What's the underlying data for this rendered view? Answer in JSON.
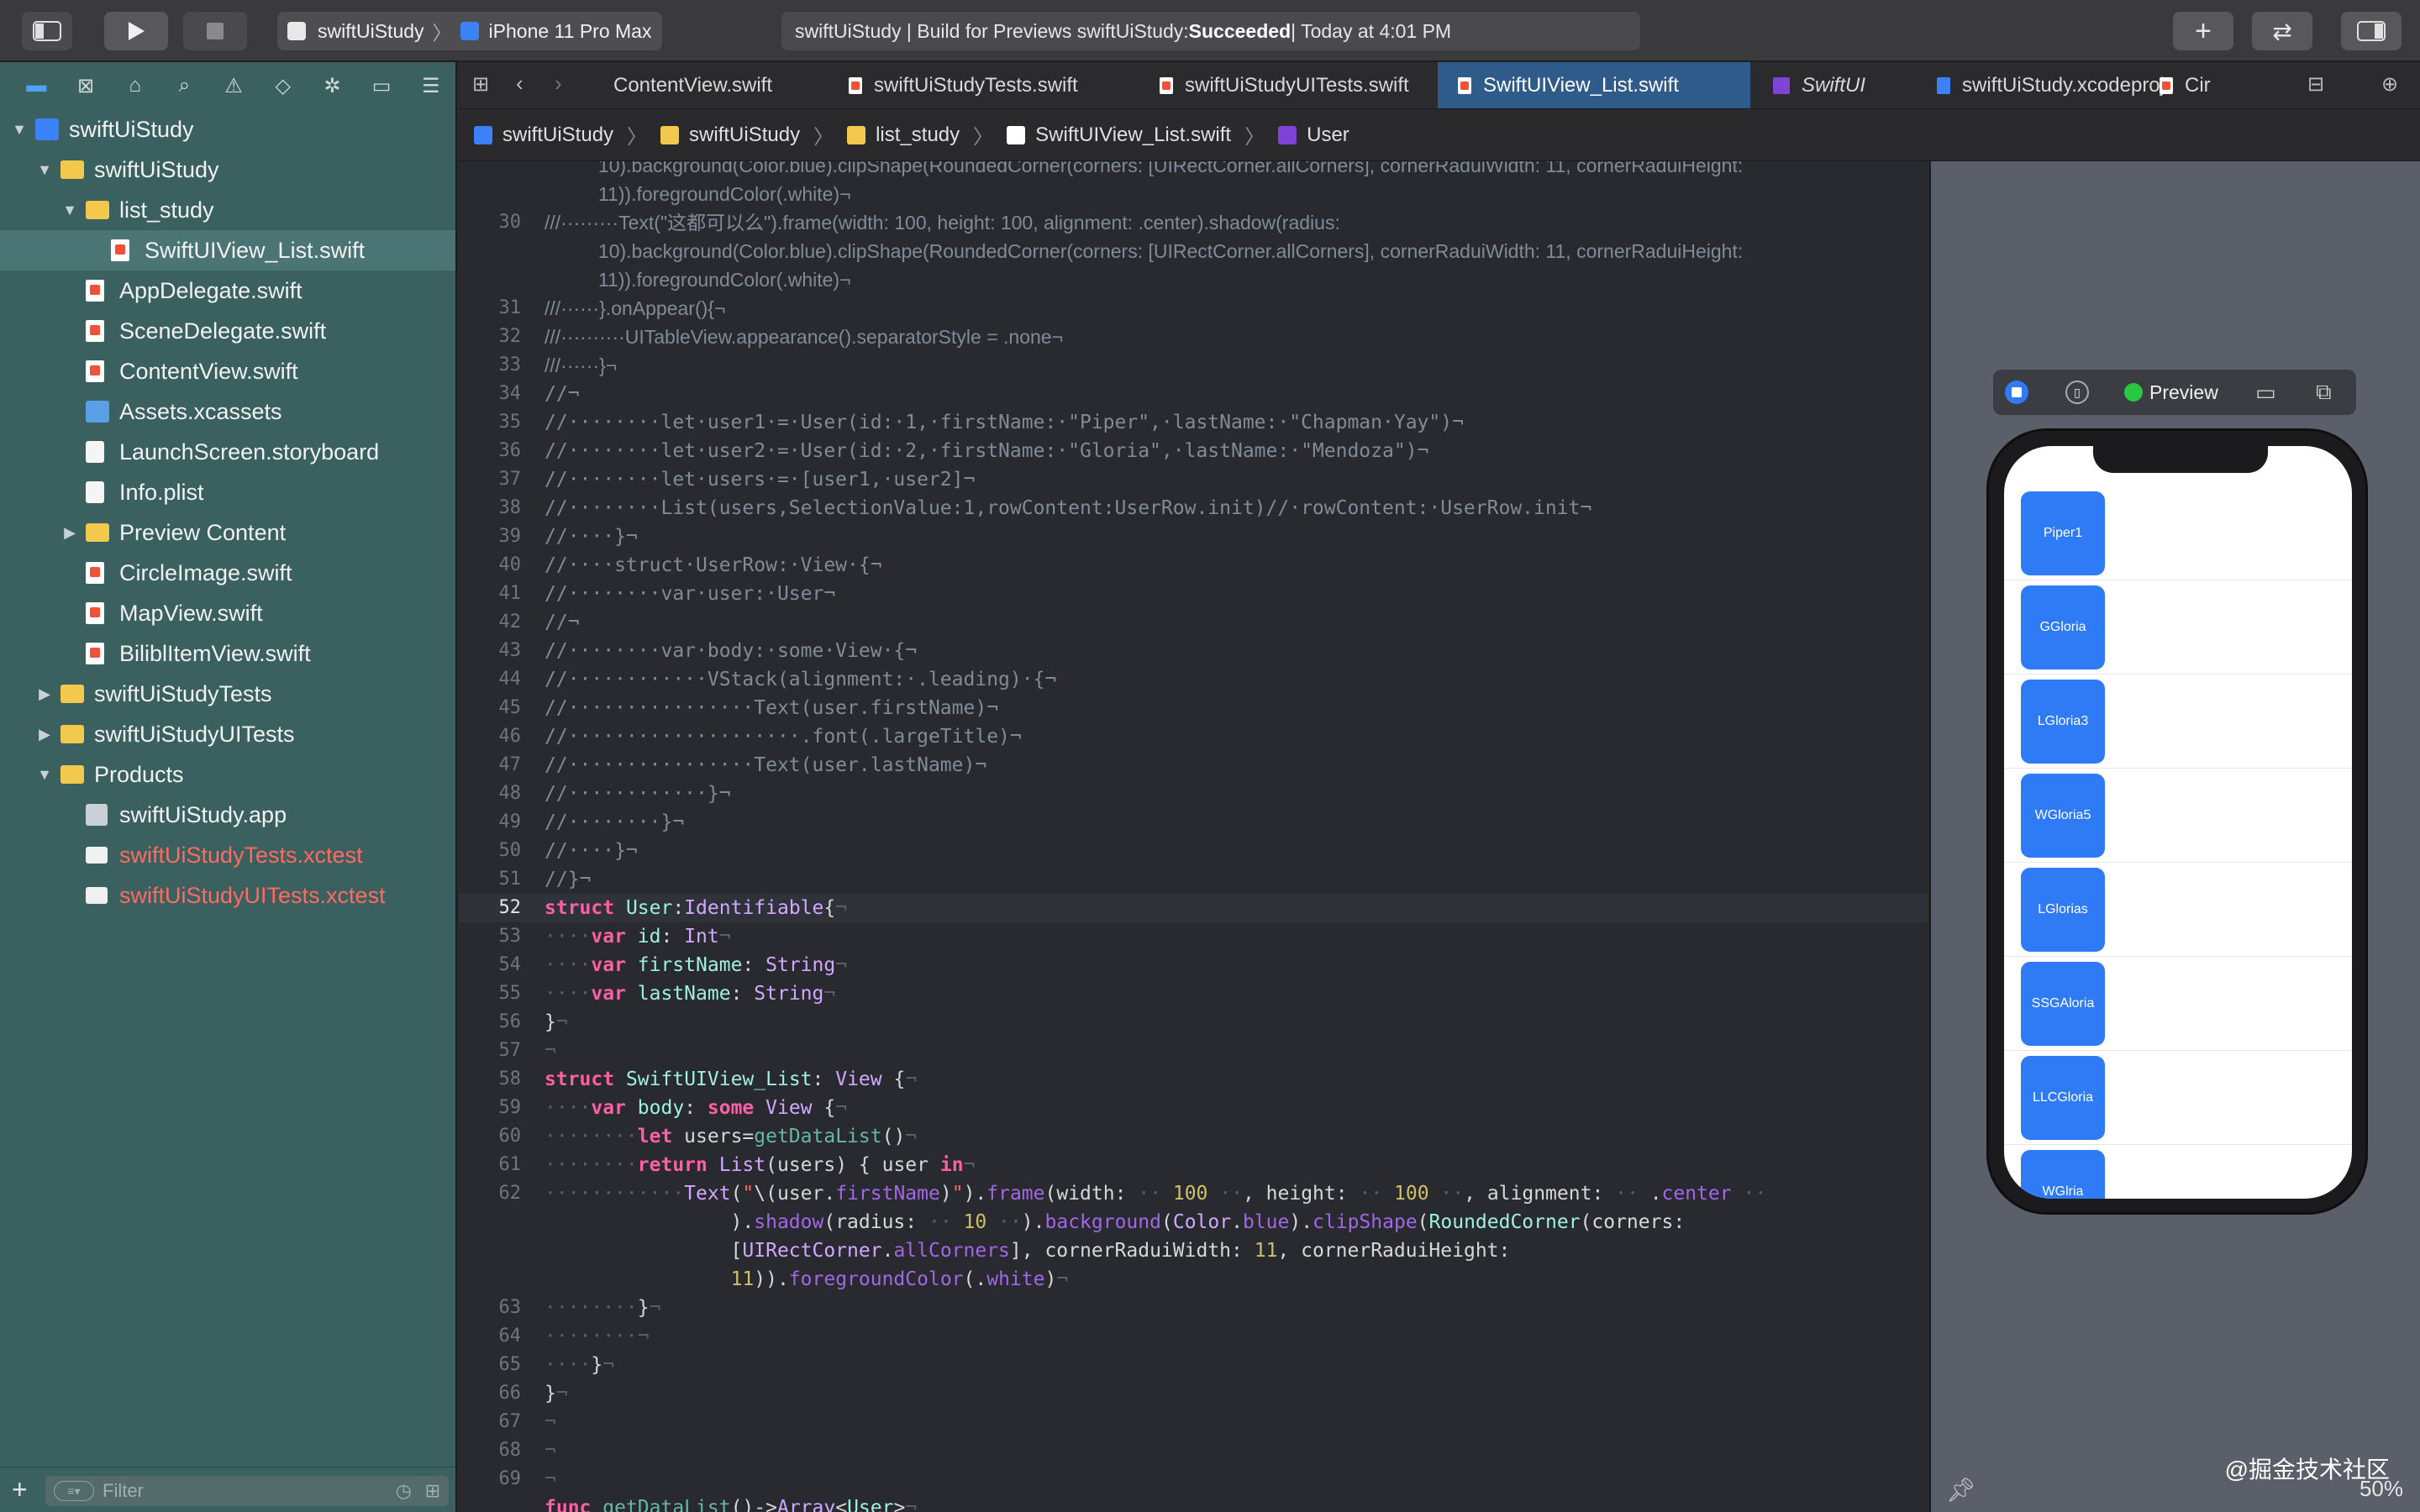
{
  "toolbar": {
    "scheme": "swiftUiStudy",
    "destination": "iPhone 11 Pro Max",
    "activity_prefix": "swiftUiStudy | Build for Previews swiftUiStudy: ",
    "activity_status": "Succeeded",
    "activity_suffix": " | Today at 4:01 PM"
  },
  "navigator": {
    "tree": [
      {
        "label": "swiftUiStudy",
        "depth": 0,
        "icon": "project",
        "expand": "open"
      },
      {
        "label": "swiftUiStudy",
        "depth": 1,
        "icon": "folder",
        "expand": "open"
      },
      {
        "label": "list_study",
        "depth": 2,
        "icon": "folder",
        "expand": "open"
      },
      {
        "label": "SwiftUIView_List.swift",
        "depth": 3,
        "icon": "swift",
        "selected": true
      },
      {
        "label": "AppDelegate.swift",
        "depth": 2,
        "icon": "swift"
      },
      {
        "label": "SceneDelegate.swift",
        "depth": 2,
        "icon": "swift"
      },
      {
        "label": "ContentView.swift",
        "depth": 2,
        "icon": "swift"
      },
      {
        "label": "Assets.xcassets",
        "depth": 2,
        "icon": "xcassets"
      },
      {
        "label": "LaunchScreen.storyboard",
        "depth": 2,
        "icon": "doc"
      },
      {
        "label": "Info.plist",
        "depth": 2,
        "icon": "doc"
      },
      {
        "label": "Preview Content",
        "depth": 2,
        "icon": "folder",
        "expand": "closed"
      },
      {
        "label": "CircleImage.swift",
        "depth": 2,
        "icon": "swift"
      },
      {
        "label": "MapView.swift",
        "depth": 2,
        "icon": "swift"
      },
      {
        "label": "BiliblItemView.swift",
        "depth": 2,
        "icon": "swift"
      },
      {
        "label": "swiftUiStudyTests",
        "depth": 1,
        "icon": "folder",
        "expand": "closed"
      },
      {
        "label": "swiftUiStudyUITests",
        "depth": 1,
        "icon": "folder",
        "expand": "closed"
      },
      {
        "label": "Products",
        "depth": 1,
        "icon": "folder",
        "expand": "open"
      },
      {
        "label": "swiftUiStudy.app",
        "depth": 2,
        "icon": "app"
      },
      {
        "label": "swiftUiStudyTests.xctest",
        "depth": 2,
        "icon": "test",
        "red": true
      },
      {
        "label": "swiftUiStudyUITests.xctest",
        "depth": 2,
        "icon": "test",
        "red": true
      }
    ],
    "filter_placeholder": "Filter"
  },
  "tabs": [
    {
      "label": "ContentView.swift",
      "icon": "none"
    },
    {
      "label": "swiftUiStudyTests.swift",
      "icon": "swift"
    },
    {
      "label": "swiftUiStudyUITests.swift",
      "icon": "swift"
    },
    {
      "label": "SwiftUIView_List.swift",
      "icon": "swift",
      "active": true
    },
    {
      "label": "SwiftUI",
      "icon": "module"
    },
    {
      "label": "swiftUiStudy.xcodeproj",
      "icon": "project"
    },
    {
      "label": "Cir",
      "icon": "swift"
    }
  ],
  "jumpbar": [
    "swiftUiStudy",
    "swiftUiStudy",
    "list_study",
    "SwiftUIView_List.swift",
    "User"
  ],
  "code_lines": [
    {
      "n": "",
      "t": "c",
      "s": "          10).background(Color.blue).clipShape(RoundedCorner(corners: [UIRectCorner.allCorners], cornerRaduiWidth: 11, cornerRaduiHeight:"
    },
    {
      "n": "",
      "t": "c",
      "s": "          11)).foregroundColor(.white)¬"
    },
    {
      "n": "30",
      "t": "c",
      "s": "///·········Text(\"这都可以么\").frame(width: 100, height: 100, alignment: .center).shadow(radius:"
    },
    {
      "n": "",
      "t": "c",
      "s": "          10).background(Color.blue).clipShape(RoundedCorner(corners: [UIRectCorner.allCorners], cornerRaduiWidth: 11, cornerRaduiHeight:"
    },
    {
      "n": "",
      "t": "c",
      "s": "          11)).foregroundColor(.white)¬"
    },
    {
      "n": "31",
      "t": "c",
      "s": "///······}.onAppear(){¬"
    },
    {
      "n": "32",
      "t": "c",
      "s": "///··········UITableView.appearance().separatorStyle = .none¬"
    },
    {
      "n": "33",
      "t": "c",
      "s": "///······}¬"
    },
    {
      "n": "34",
      "t": "m",
      "s": "//¬"
    },
    {
      "n": "35",
      "t": "m",
      "s": "//········let·user1·=·User(id:·1,·firstName:·\"Piper\",·lastName:·\"Chapman·Yay\")¬"
    },
    {
      "n": "36",
      "t": "m",
      "s": "//········let·user2·=·User(id:·2,·firstName:·\"Gloria\",·lastName:·\"Mendoza\")¬"
    },
    {
      "n": "37",
      "t": "m",
      "s": "//········let·users·=·[user1,·user2]¬"
    },
    {
      "n": "38",
      "t": "m",
      "s": "//········List(users,SelectionValue:1,rowContent:UserRow.init)//·rowContent:·UserRow.init¬"
    },
    {
      "n": "39",
      "t": "m",
      "s": "//····}¬"
    },
    {
      "n": "40",
      "t": "m",
      "s": "//····struct·UserRow:·View·{¬"
    },
    {
      "n": "41",
      "t": "m",
      "s": "//········var·user:·User¬"
    },
    {
      "n": "42",
      "t": "m",
      "s": "//¬"
    },
    {
      "n": "43",
      "t": "m",
      "s": "//········var·body:·some·View·{¬"
    },
    {
      "n": "44",
      "t": "m",
      "s": "//············VStack(alignment:·.leading)·{¬"
    },
    {
      "n": "45",
      "t": "m",
      "s": "//················Text(user.firstName)¬"
    },
    {
      "n": "46",
      "t": "m",
      "s": "//····················.font(.largeTitle)¬"
    },
    {
      "n": "47",
      "t": "m",
      "s": "//················Text(user.lastName)¬"
    },
    {
      "n": "48",
      "t": "m",
      "s": "//············}¬"
    },
    {
      "n": "49",
      "t": "m",
      "s": "//········}¬"
    },
    {
      "n": "50",
      "t": "m",
      "s": "//····}¬"
    },
    {
      "n": "51",
      "t": "m",
      "s": "//}¬"
    },
    {
      "n": "52",
      "t": "x",
      "cur": true,
      "s": "<span class=kw>struct</span> <span class=ty2>User</span>:<span class=typ>Identifiable</span>{<span class=ws>¬</span>"
    },
    {
      "n": "53",
      "t": "x",
      "s": "<span class=ws>····</span><span class=kw>var</span> <span class=ty2>id</span>: <span class=typ>Int</span><span class=ws>¬</span>"
    },
    {
      "n": "54",
      "t": "x",
      "s": "<span class=ws>····</span><span class=kw>var</span> <span class=ty2>firstName</span>: <span class=typ>String</span><span class=ws>¬</span>"
    },
    {
      "n": "55",
      "t": "x",
      "s": "<span class=ws>····</span><span class=kw>var</span> <span class=ty2>lastName</span>: <span class=typ>String</span><span class=ws>¬</span>"
    },
    {
      "n": "56",
      "t": "x",
      "s": "}<span class=ws>¬</span>"
    },
    {
      "n": "57",
      "t": "x",
      "s": "<span class=ws>¬</span>"
    },
    {
      "n": "58",
      "t": "x",
      "s": "<span class=kw>struct</span> <span class=ty2>SwiftUIView_List</span>: <span class=typ>View</span> {<span class=ws>¬</span>"
    },
    {
      "n": "59",
      "t": "x",
      "s": "<span class=ws>····</span><span class=kw>var</span> <span class=ty2>body</span>: <span class=kw>some</span> <span class=typ>View</span> {<span class=ws>¬</span>"
    },
    {
      "n": "60",
      "t": "x",
      "s": "<span class=ws>········</span><span class=kw>let</span> users=<span class=fn>getDataList</span>()<span class=ws>¬</span>"
    },
    {
      "n": "61",
      "t": "x",
      "s": "<span class=ws>········</span><span class=kw>return</span> <span class=typ>List</span>(users) { user <span class=kw>in</span><span class=ws>¬</span>"
    },
    {
      "n": "62",
      "t": "x",
      "s": "<span class=ws>············</span><span class=typ>Text</span>(<span class=str>\"</span>\\(user.<span class=prop>firstName</span>)<span class=str>\"</span>).<span class=prop>frame</span>(width: <span class=ws>··</span> <span class=num>100</span> <span class=ws>··</span>, height: <span class=ws>··</span> <span class=num>100</span> <span class=ws>··</span>, alignment: <span class=ws>··</span> .<span class=prop>center</span> <span class=ws>··</span>"
    },
    {
      "n": "",
      "t": "x",
      "s": "                ).<span class=prop>shadow</span>(radius: <span class=ws>··</span> <span class=num>10</span> <span class=ws>··</span>).<span class=prop>background</span>(<span class=typ>Color</span>.<span class=prop>blue</span>).<span class=prop>clipShape</span>(<span class=ty2>RoundedCorner</span>(corners:"
    },
    {
      "n": "",
      "t": "x",
      "s": "                [<span class=typ>UIRectCorner</span>.<span class=prop>allCorners</span>], cornerRaduiWidth: <span class=num>11</span>, cornerRaduiHeight:"
    },
    {
      "n": "",
      "t": "x",
      "s": "                <span class=num>11</span>)).<span class=prop>foregroundColor</span>(.<span class=prop>white</span>)<span class=ws>¬</span>"
    },
    {
      "n": "63",
      "t": "x",
      "s": "<span class=ws>········</span>}<span class=ws>¬</span>"
    },
    {
      "n": "64",
      "t": "x",
      "s": "<span class=ws>········¬</span>"
    },
    {
      "n": "65",
      "t": "x",
      "s": "<span class=ws>····</span>}<span class=ws>¬</span>"
    },
    {
      "n": "66",
      "t": "x",
      "s": "}<span class=ws>¬</span>"
    },
    {
      "n": "67",
      "t": "x",
      "s": "<span class=ws>¬</span>"
    },
    {
      "n": "68",
      "t": "x",
      "s": "<span class=ws>¬</span>"
    },
    {
      "n": "69",
      "t": "x",
      "s": "<span class=ws>¬</span>"
    },
    {
      "n": "",
      "t": "x",
      "s": "<span class=kw>func</span> <span class=fn>getDataList</span>()-&gt;<span class=typ>Array</span>&lt;<span class=ty2>User</span>&gt;<span class=ws>¬</span>"
    }
  ],
  "preview": {
    "label": "Preview",
    "list_items": [
      "Piper1",
      "GGloria",
      "LGloria3",
      "WGloria5",
      "LGlorias",
      "SSGAloria",
      "LLCGloria",
      "WGlria"
    ],
    "zoom": "50%"
  },
  "watermark": "@掘金技术社区",
  "colors": {
    "accent": "#2f7bf5",
    "navigator": "#3a6060",
    "editor": "#292a30",
    "status_ok": "#28c840"
  }
}
